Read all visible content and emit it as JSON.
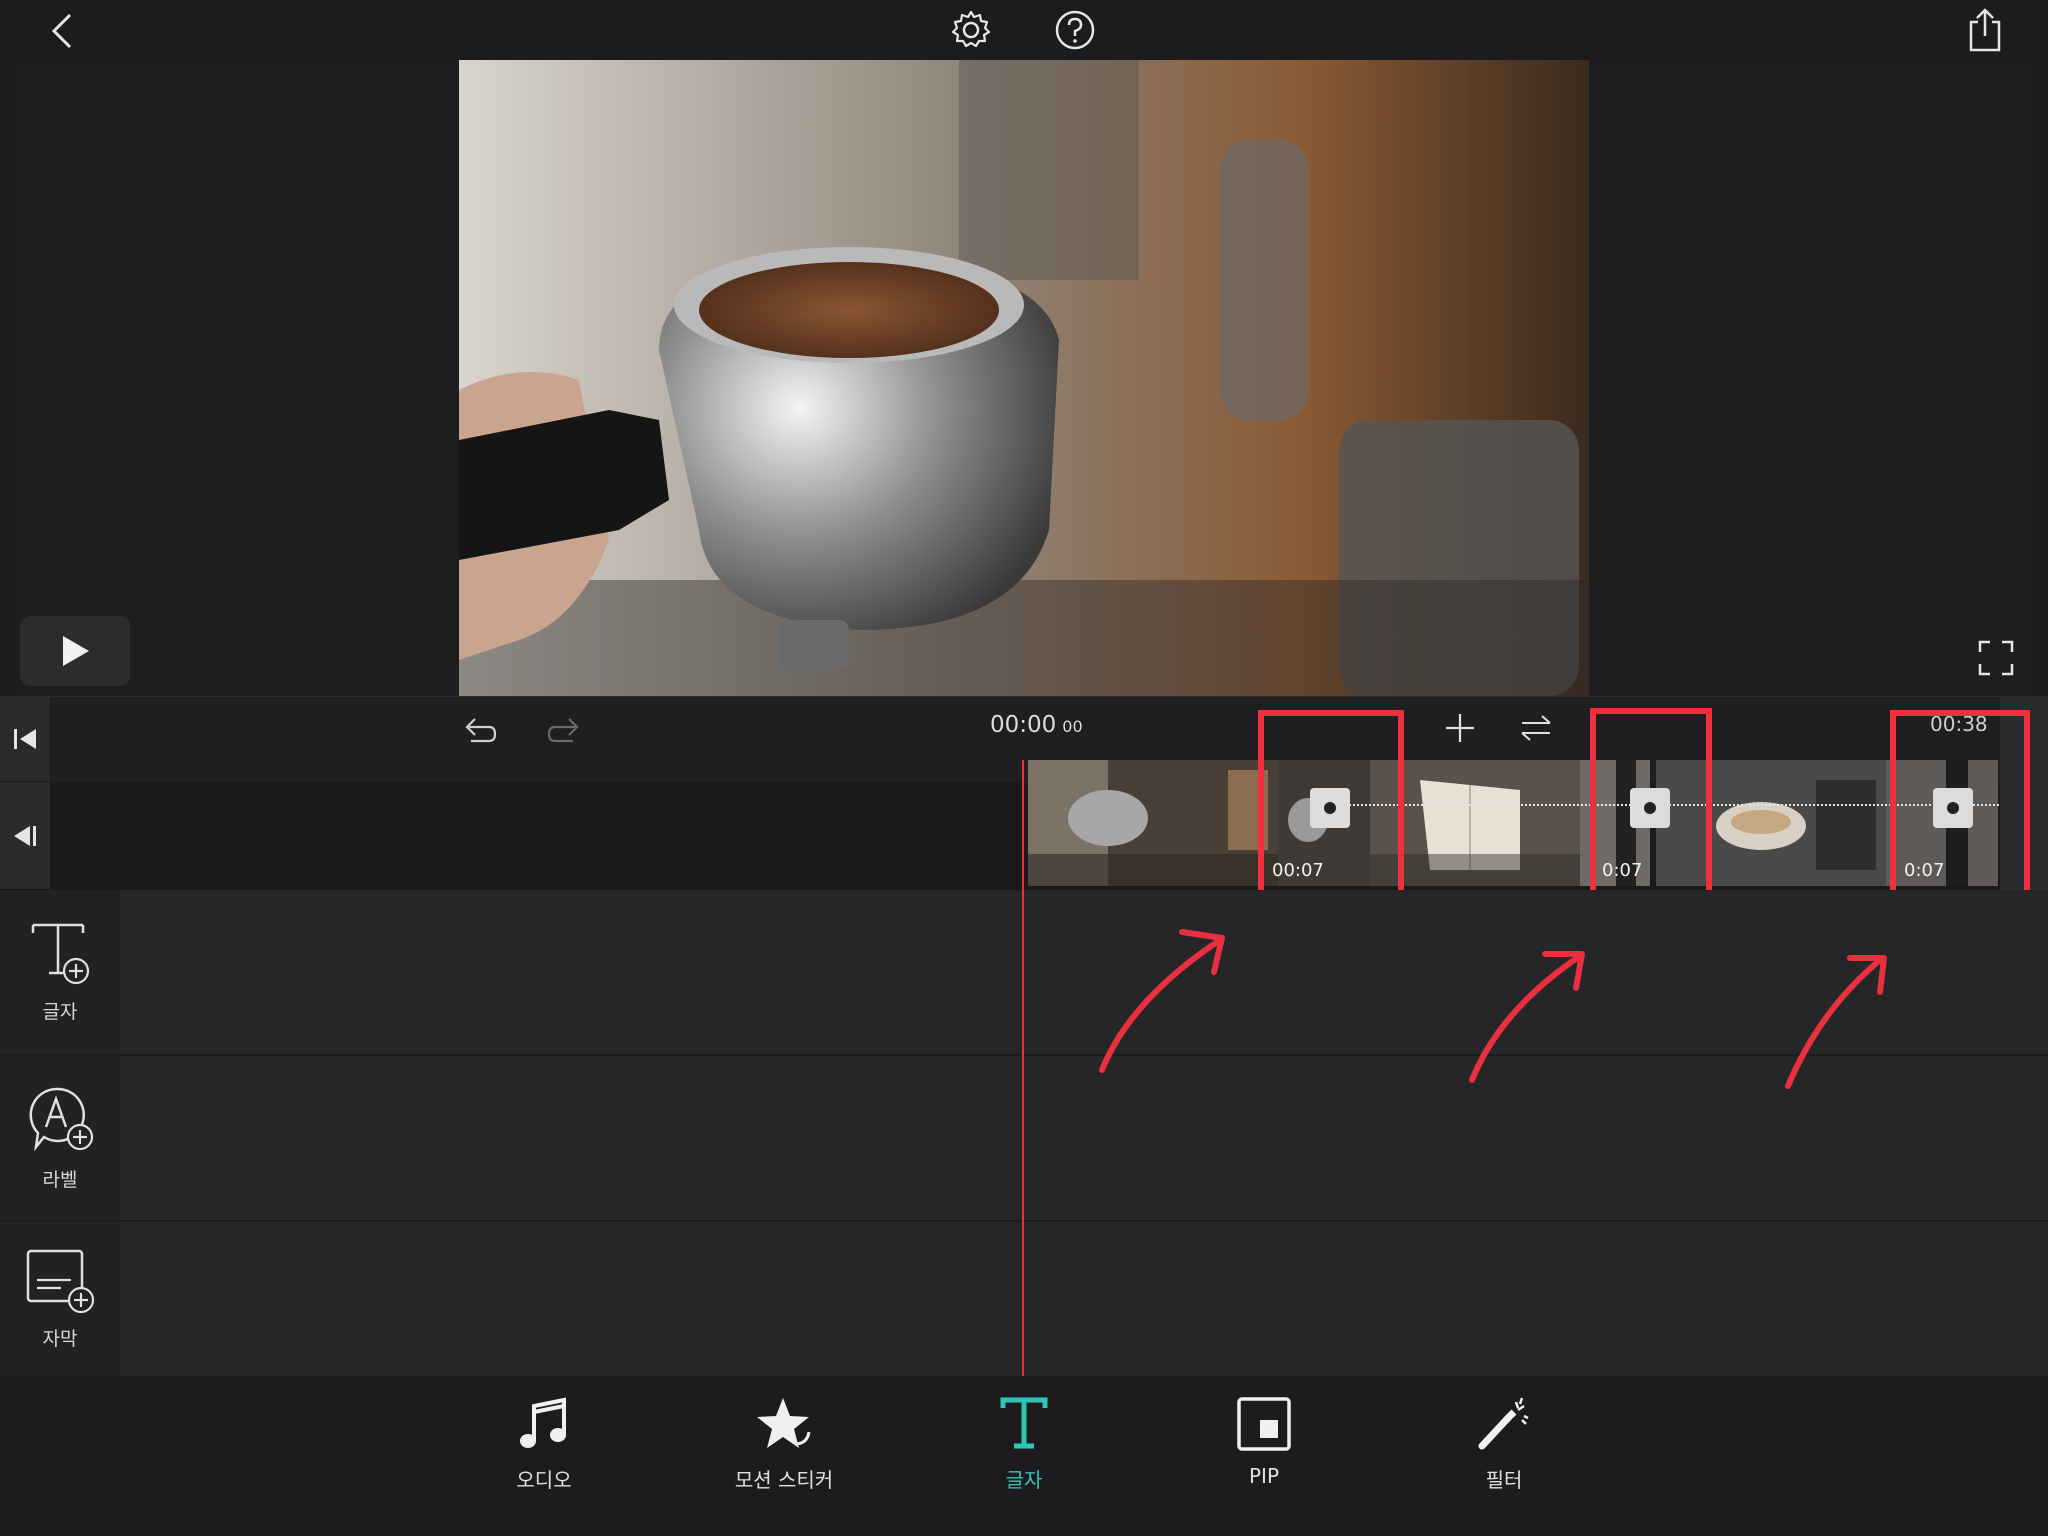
{
  "timeline": {
    "current_time": "00:00",
    "current_frames": "00",
    "end_time": "00:38",
    "transitions": [
      {
        "duration": "00:07"
      },
      {
        "duration": "0:07"
      },
      {
        "duration": "0:07"
      }
    ]
  },
  "tracks": [
    {
      "label": "글자",
      "icon": "text-add-icon"
    },
    {
      "label": "라벨",
      "icon": "label-add-icon"
    },
    {
      "label": "자막",
      "icon": "subtitle-add-icon"
    }
  ],
  "bottom_toolbar": [
    {
      "label": "오디오",
      "icon": "music-note-icon"
    },
    {
      "label": "모션 스티커",
      "icon": "star-sticker-icon"
    },
    {
      "label": "글자",
      "icon": "text-icon",
      "active": true
    },
    {
      "label": "PIP",
      "icon": "pip-icon"
    },
    {
      "label": "필터",
      "icon": "magic-wand-icon"
    }
  ],
  "colors": {
    "accent": "#2ec6b8",
    "playhead": "#e8303e",
    "annotation": "#f0303f",
    "background": "#1c1c1e"
  }
}
